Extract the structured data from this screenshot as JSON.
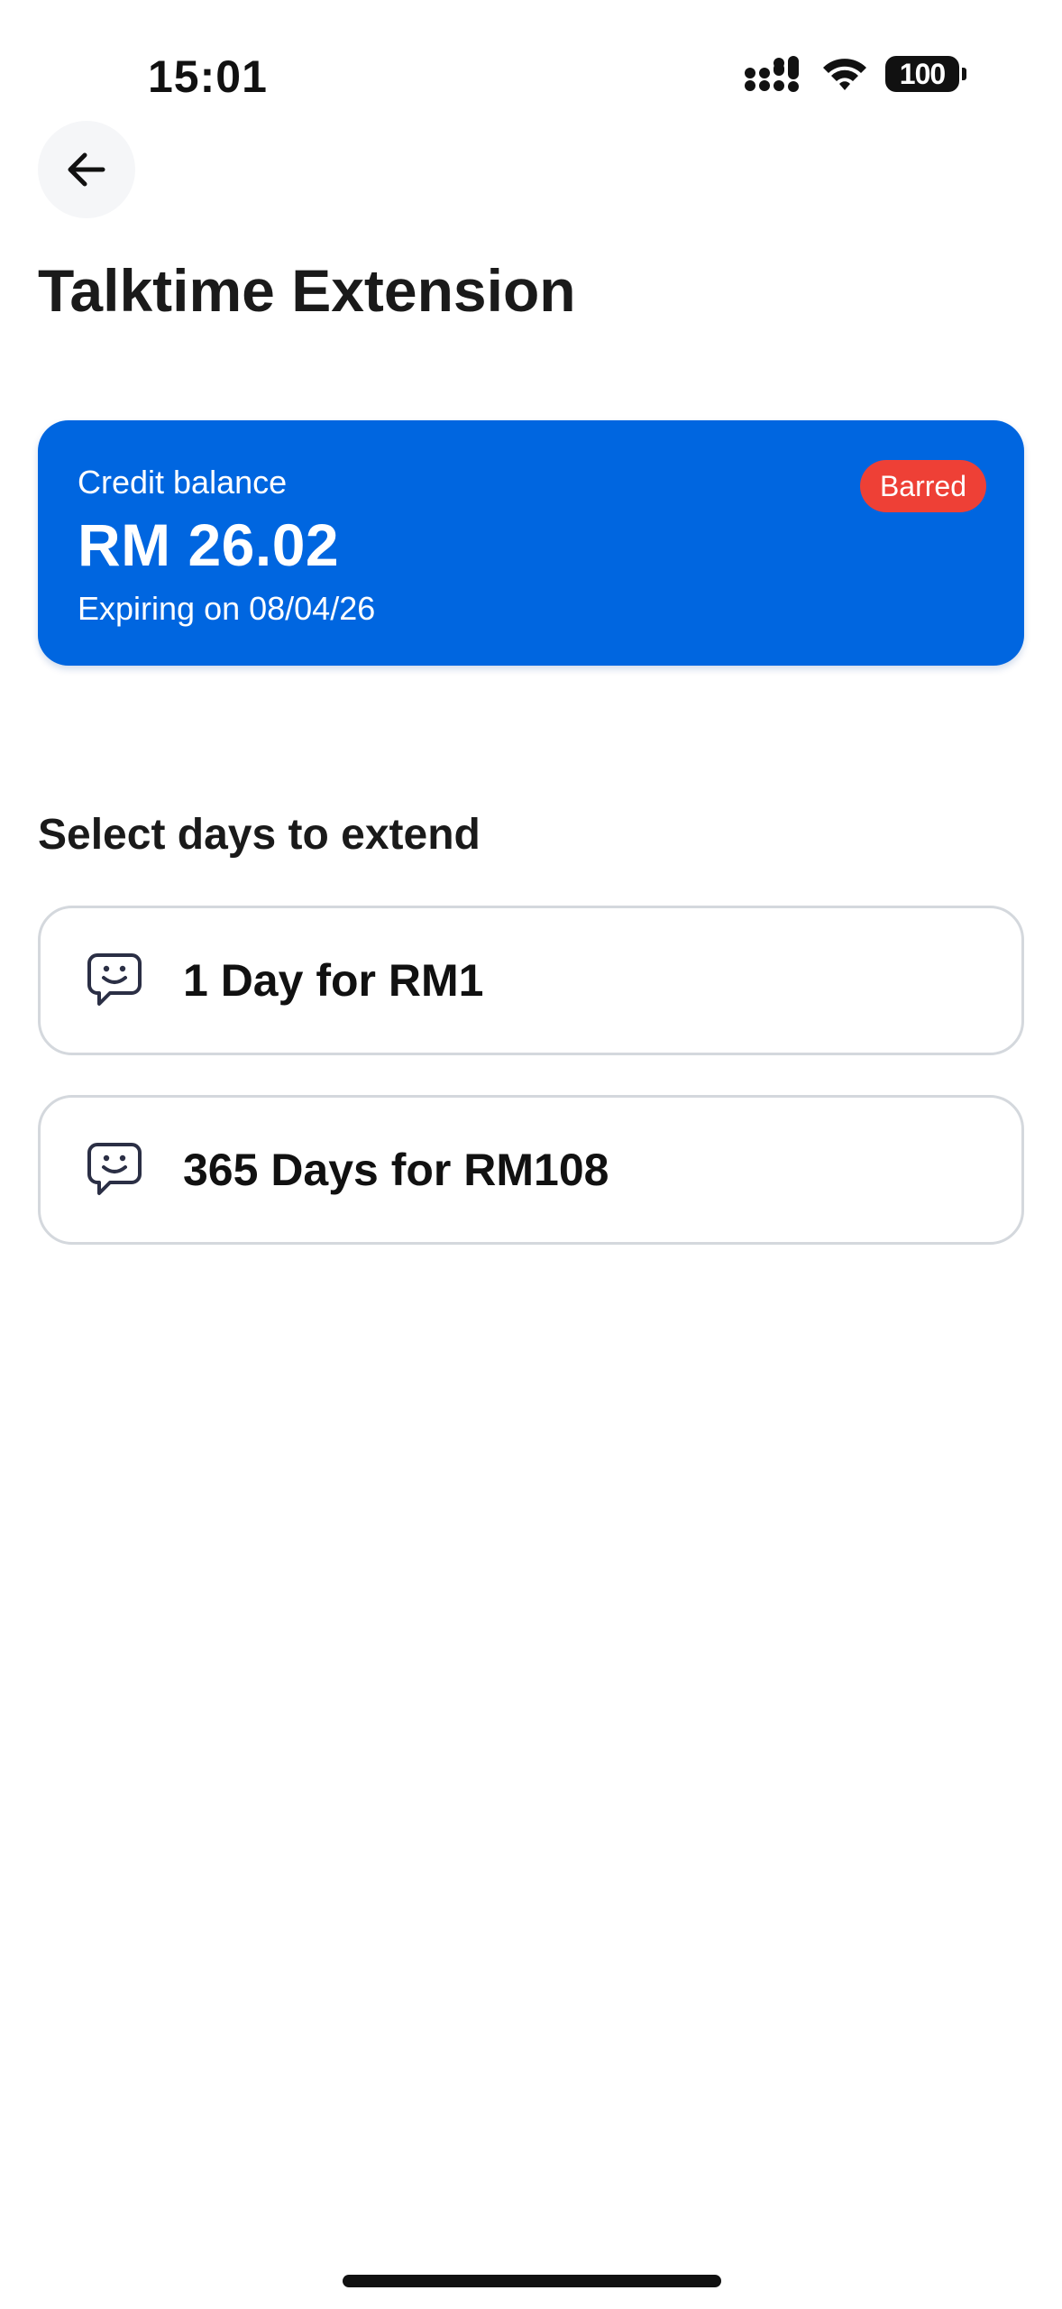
{
  "status_bar": {
    "time": "15:01",
    "battery": "100",
    "icons": [
      "signal-icon",
      "wifi-icon",
      "battery-icon"
    ]
  },
  "header": {
    "back_icon": "arrow-left-icon",
    "title": "Talktime Extension"
  },
  "balance_card": {
    "label": "Credit balance",
    "amount": "RM 26.02",
    "expiry": "Expiring on 08/04/26",
    "badge": "Barred",
    "colors": {
      "card": "#0066e0",
      "badge": "#ee4036"
    }
  },
  "extend": {
    "section_title": "Select days to extend",
    "options": [
      {
        "label": "1 Day for RM1",
        "icon": "smiley-chat-icon"
      },
      {
        "label": "365 Days for RM108",
        "icon": "smiley-chat-icon"
      }
    ]
  }
}
